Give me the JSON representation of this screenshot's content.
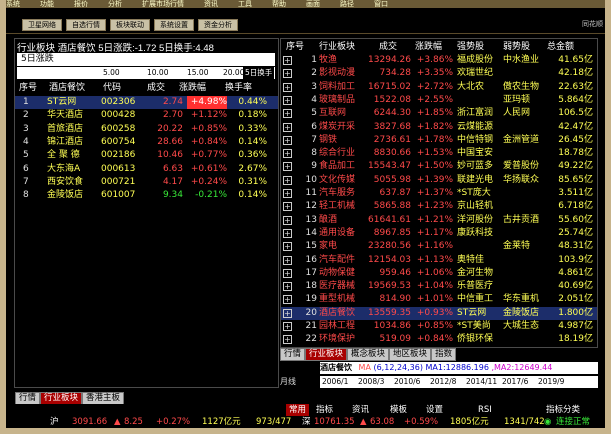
{
  "menubar": {
    "items": [
      "系统",
      "功能",
      "报价",
      "分析",
      "扩展市场行情",
      "资讯",
      "工具",
      "帮助",
      "画面",
      "路径",
      "窗口"
    ]
  },
  "toolbar": {
    "buttons": [
      "卫星网络",
      "自选行情",
      "板块联动",
      "系统设置",
      "资金分析"
    ],
    "right_text": "同花顺"
  },
  "left_panel": {
    "header": "行业板块  酒店餐饮  5日涨跌:-1.72  5日换手:4.48",
    "tabs_top": [
      "5日涨跌"
    ],
    "mini_axis": [
      "5.00",
      "10.00",
      "15.00",
      "20.00",
      "5日换手"
    ],
    "columns": [
      "序号",
      "酒店餐饮",
      "代码",
      "成交",
      "涨跌幅",
      "换手率"
    ],
    "rows": [
      {
        "no": "1",
        "name": "ST云网",
        "code": "002306",
        "price": "2.74",
        "chg": "+4.98%",
        "turn": "0.44%"
      },
      {
        "no": "2",
        "name": "华天酒店",
        "code": "000428",
        "price": "2.70",
        "chg": "+1.12%",
        "turn": "0.18%"
      },
      {
        "no": "3",
        "name": "首旅酒店",
        "code": "600258",
        "price": "20.22",
        "chg": "+0.85%",
        "turn": "0.33%"
      },
      {
        "no": "4",
        "name": "锦江酒店",
        "code": "600754",
        "price": "28.66",
        "chg": "+0.84%",
        "turn": "0.14%"
      },
      {
        "no": "5",
        "name": "全 聚 德",
        "code": "002186",
        "price": "10.46",
        "chg": "+0.77%",
        "turn": "0.36%"
      },
      {
        "no": "6",
        "name": "大东海A",
        "code": "000613",
        "price": "6.63",
        "chg": "+0.61%",
        "turn": "2.67%"
      },
      {
        "no": "7",
        "name": "西安饮食",
        "code": "000721",
        "price": "4.17",
        "chg": "+0.24%",
        "turn": "0.31%"
      },
      {
        "no": "8",
        "name": "金陵饭店",
        "code": "601007",
        "price": "9.34",
        "chg": "-0.21%",
        "turn": "0.14%"
      }
    ],
    "bottom_tabs": [
      "行情",
      "行业板块",
      "香港主板"
    ]
  },
  "right_panel": {
    "columns": [
      "序号",
      "行业板块",
      "成交",
      "涨跌幅",
      "强势股",
      "弱势股",
      "总金额"
    ],
    "rows": [
      {
        "no": "1",
        "name": "牧渔",
        "price": "13294.26",
        "chg": "+3.86%",
        "strong": "福成股份",
        "weak": "中水渔业",
        "amt": "41.65亿"
      },
      {
        "no": "2",
        "name": "影视动漫",
        "price": "734.28",
        "chg": "+3.35%",
        "strong": "欢瑞世纪",
        "weak": "",
        "amt": "42.18亿"
      },
      {
        "no": "3",
        "name": "饲料加工",
        "price": "16715.02",
        "chg": "+2.72%",
        "strong": "大北农",
        "weak": "傲农生物",
        "amt": "22.63亿"
      },
      {
        "no": "4",
        "name": "玻璃制品",
        "price": "1522.08",
        "chg": "+2.55%",
        "strong": "",
        "weak": "亚玛顿",
        "amt": "5.864亿"
      },
      {
        "no": "5",
        "name": "互联网",
        "price": "6244.30",
        "chg": "+1.85%",
        "strong": "浙江富润",
        "weak": "人民网",
        "amt": "106.5亿"
      },
      {
        "no": "6",
        "name": "煤炭开采",
        "price": "3827.68",
        "chg": "+1.82%",
        "strong": "云煤能源",
        "weak": "",
        "amt": "42.47亿"
      },
      {
        "no": "7",
        "name": "钢铁",
        "price": "2736.61",
        "chg": "+1.78%",
        "strong": "中信特钢",
        "weak": "金洲管道",
        "amt": "26.45亿"
      },
      {
        "no": "8",
        "name": "综合行业",
        "price": "8830.66",
        "chg": "+1.53%",
        "strong": "中国宝安",
        "weak": "",
        "amt": "18.78亿"
      },
      {
        "no": "9",
        "name": "食品加工",
        "price": "15543.47",
        "chg": "+1.50%",
        "strong": "妙可蓝多",
        "weak": "爱普股份",
        "amt": "49.22亿"
      },
      {
        "no": "10",
        "name": "文化传媒",
        "price": "5055.98",
        "chg": "+1.39%",
        "strong": "联建光电",
        "weak": "华扬联众",
        "amt": "85.65亿"
      },
      {
        "no": "11",
        "name": "汽车服务",
        "price": "637.87",
        "chg": "+1.37%",
        "strong": "*ST庞大",
        "weak": "",
        "amt": "3.511亿"
      },
      {
        "no": "12",
        "name": "轻工机械",
        "price": "5865.88",
        "chg": "+1.23%",
        "strong": "京山轻机",
        "weak": "",
        "amt": "6.718亿"
      },
      {
        "no": "13",
        "name": "酿酒",
        "price": "61641.61",
        "chg": "+1.21%",
        "strong": "洋河股份",
        "weak": "古井贡酒",
        "amt": "55.60亿"
      },
      {
        "no": "14",
        "name": "通用设备",
        "price": "8967.85",
        "chg": "+1.17%",
        "strong": "康跃科技",
        "weak": "",
        "amt": "25.74亿"
      },
      {
        "no": "15",
        "name": "家电",
        "price": "23280.56",
        "chg": "+1.16%",
        "strong": "",
        "weak": "金莱特",
        "amt": "48.31亿"
      },
      {
        "no": "16",
        "name": "汽车配件",
        "price": "12154.03",
        "chg": "+1.13%",
        "strong": "奥特佳",
        "weak": "",
        "amt": "103.9亿"
      },
      {
        "no": "17",
        "name": "动物保健",
        "price": "959.46",
        "chg": "+1.06%",
        "strong": "金河生物",
        "weak": "",
        "amt": "4.861亿"
      },
      {
        "no": "18",
        "name": "医疗器械",
        "price": "19569.53",
        "chg": "+1.04%",
        "strong": "乐普医疗",
        "weak": "",
        "amt": "40.69亿"
      },
      {
        "no": "19",
        "name": "重型机械",
        "price": "814.90",
        "chg": "+1.01%",
        "strong": "中信重工",
        "weak": "华东重机",
        "amt": "2.051亿"
      },
      {
        "no": "20",
        "name": "酒店餐饮",
        "price": "13559.35",
        "chg": "+0.93%",
        "strong": "ST云网",
        "weak": "金陵饭店",
        "amt": "1.800亿"
      },
      {
        "no": "21",
        "name": "园林工程",
        "price": "1034.86",
        "chg": "+0.85%",
        "strong": "*ST美尚",
        "weak": "大城生态",
        "amt": "4.987亿"
      },
      {
        "no": "22",
        "name": "环境保护",
        "price": "519.09",
        "chg": "+0.84%",
        "strong": "侨银环保",
        "weak": "",
        "amt": "18.19亿"
      }
    ],
    "bottom_tabs": [
      "行情",
      "行业板块",
      "概念板块",
      "地区板块",
      "指数"
    ]
  },
  "chart": {
    "title": "酒店餐饮",
    "ma_label": "MA",
    "ma_params": "(6,12,24,36)",
    "ma1": "MA1:12886.196",
    "ma2": ",MA2:12649.44",
    "years": [
      "2006/1",
      "2008/3",
      "2010/6",
      "2012/8",
      "2014/11",
      "2017/6",
      "2019/9"
    ],
    "period": "月线"
  },
  "status_bar": {
    "sh_label": "沪",
    "sh_index": "3091.66",
    "sh_chg": "8.25",
    "sh_pct": "+0.27%",
    "sh_amt": "1127亿元",
    "sh_updown": "973/477",
    "sz_label": "深",
    "sz_index": "10761.35",
    "sz_chg": "63.08",
    "sz_pct": "+0.59%",
    "sz_amt": "1805亿元",
    "sz_updown": "1341/742",
    "conn": "连接正常",
    "menu": [
      "常用",
      "指标",
      "资讯",
      "模板",
      "设置",
      "RSI",
      "指标分类"
    ]
  },
  "colors": {
    "up": "#ff4a4a",
    "down": "#38e838",
    "highlight": "#ffff55",
    "frame": "#c7b48c"
  }
}
